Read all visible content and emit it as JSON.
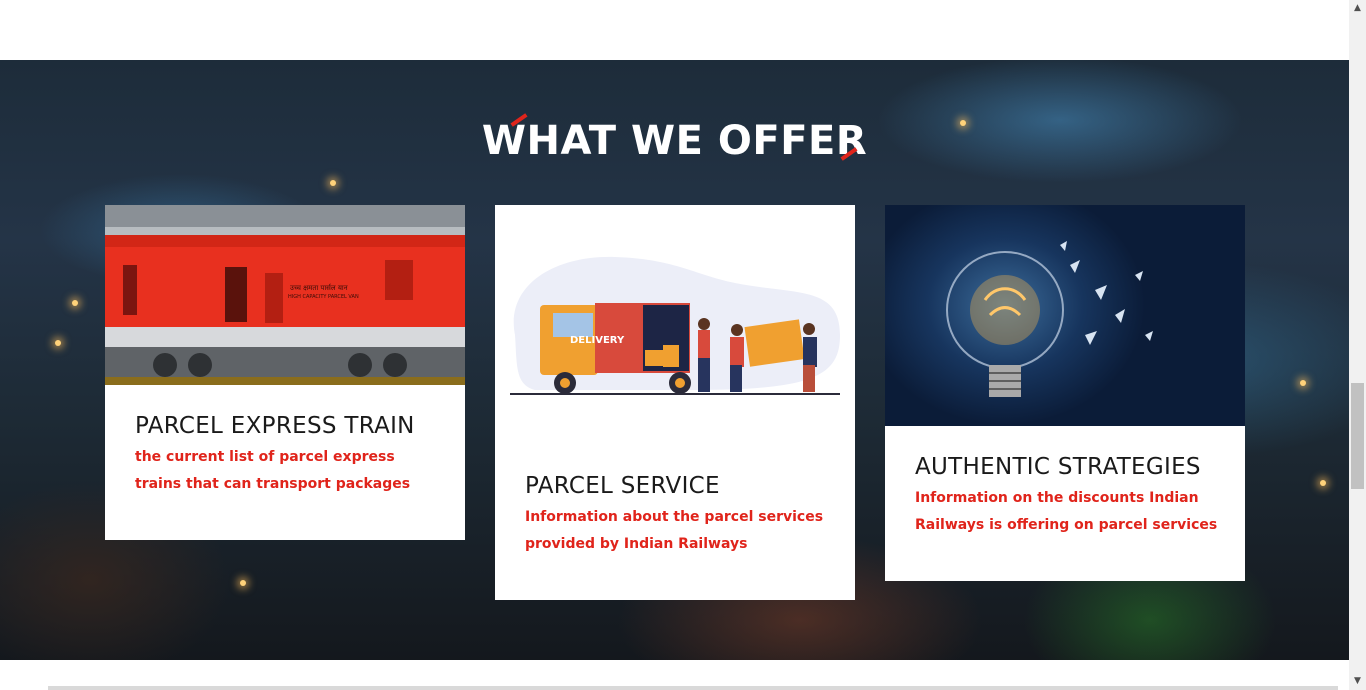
{
  "section": {
    "title": "WHAT WE OFFER"
  },
  "colors": {
    "accent": "#e0241b",
    "heading": "#1a1a1a",
    "card_bg": "#ffffff"
  },
  "cards": [
    {
      "title": "PARCEL EXPRESS TRAIN",
      "description": "the current list of parcel express trains that can transport packages",
      "image_text_hindi": "उच्च क्षमता पार्सल यान",
      "image_text_english": "HIGH CAPACITY PARCEL VAN"
    },
    {
      "title": "PARCEL SERVICE",
      "description": "Information about the parcel services provided by Indian Railways",
      "image_text": "DELIVERY"
    },
    {
      "title": "AUTHENTIC STRATEGIES",
      "description": "Information on the discounts Indian Railways is offering on parcel services"
    }
  ],
  "scrollbar": {
    "up_icon": "▲",
    "down_icon": "▼"
  }
}
